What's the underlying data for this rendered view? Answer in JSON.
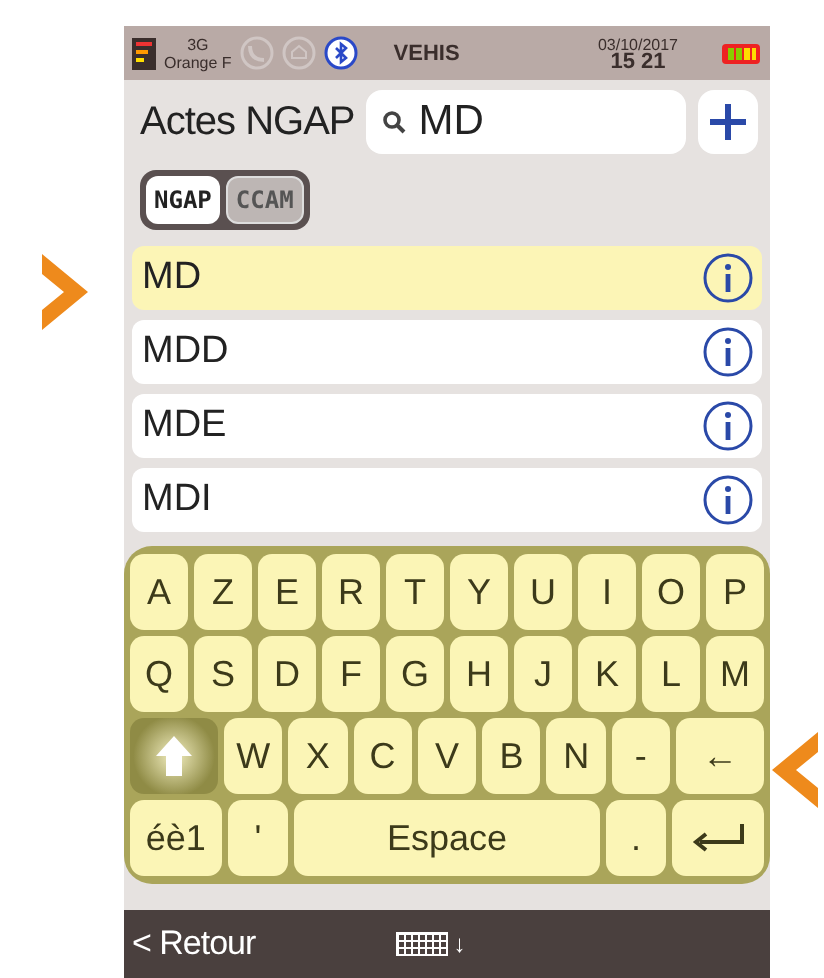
{
  "status_bar": {
    "network": "3G",
    "carrier": "Orange F",
    "app": "VEHIS",
    "date": "03/10/2017",
    "time": "15 21"
  },
  "header": {
    "title": "Actes NGAP",
    "search": {
      "value": "MD"
    }
  },
  "toggle": [
    {
      "label": "NGAP",
      "selected": true
    },
    {
      "label": "CCAM",
      "selected": false
    }
  ],
  "results": [
    {
      "label": "MD",
      "selected": true
    },
    {
      "label": "MDD",
      "selected": false
    },
    {
      "label": "MDE",
      "selected": false
    },
    {
      "label": "MDI",
      "selected": false
    }
  ],
  "keyboard": [
    [
      {
        "kind": "key",
        "label": "A"
      },
      {
        "kind": "key",
        "label": "Z"
      },
      {
        "kind": "key",
        "label": "E"
      },
      {
        "kind": "key",
        "label": "R"
      },
      {
        "kind": "key",
        "label": "T"
      },
      {
        "kind": "key",
        "label": "Y"
      },
      {
        "kind": "key",
        "label": "U"
      },
      {
        "kind": "key",
        "label": "I"
      },
      {
        "kind": "key",
        "label": "O"
      },
      {
        "kind": "key",
        "label": "P"
      }
    ],
    [
      {
        "kind": "key",
        "label": "Q"
      },
      {
        "kind": "key",
        "label": "S"
      },
      {
        "kind": "key",
        "label": "D"
      },
      {
        "kind": "key",
        "label": "F"
      },
      {
        "kind": "key",
        "label": "G"
      },
      {
        "kind": "key",
        "label": "H"
      },
      {
        "kind": "key",
        "label": "J"
      },
      {
        "kind": "key",
        "label": "K"
      },
      {
        "kind": "key",
        "label": "L"
      },
      {
        "kind": "key",
        "label": "M"
      }
    ],
    [
      {
        "kind": "shift",
        "on": true
      },
      {
        "kind": "key",
        "label": "W"
      },
      {
        "kind": "key",
        "label": "X"
      },
      {
        "kind": "key",
        "label": "C"
      },
      {
        "kind": "key",
        "label": "V"
      },
      {
        "kind": "key",
        "label": "B"
      },
      {
        "kind": "key",
        "label": "N"
      },
      {
        "kind": "key",
        "label": "-"
      },
      {
        "kind": "wide",
        "label": "←"
      }
    ],
    [
      {
        "kind": "wide",
        "label": "éè1"
      },
      {
        "kind": "key",
        "label": "'"
      },
      {
        "kind": "space",
        "label": "Espace"
      },
      {
        "kind": "key",
        "label": "."
      },
      {
        "kind": "enter"
      }
    ]
  ],
  "footer": {
    "back": "< Retour",
    "keyboard_toggle": "↓"
  }
}
